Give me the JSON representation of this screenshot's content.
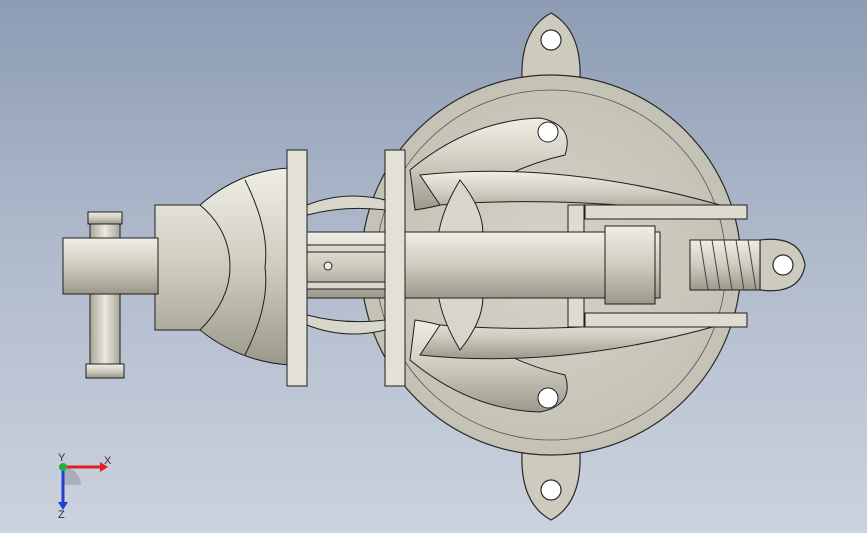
{
  "viewport": {
    "background_top": "#8d9cb4",
    "background_bottom": "#ccd3de",
    "model_color": "#cfccc0",
    "edge_color": "#2a2a2a"
  },
  "triad": {
    "x_label": "X",
    "y_label": "Y",
    "z_label": "Z",
    "x_color": "#e02020",
    "y_color": "#20b040",
    "z_color": "#2040d0"
  }
}
